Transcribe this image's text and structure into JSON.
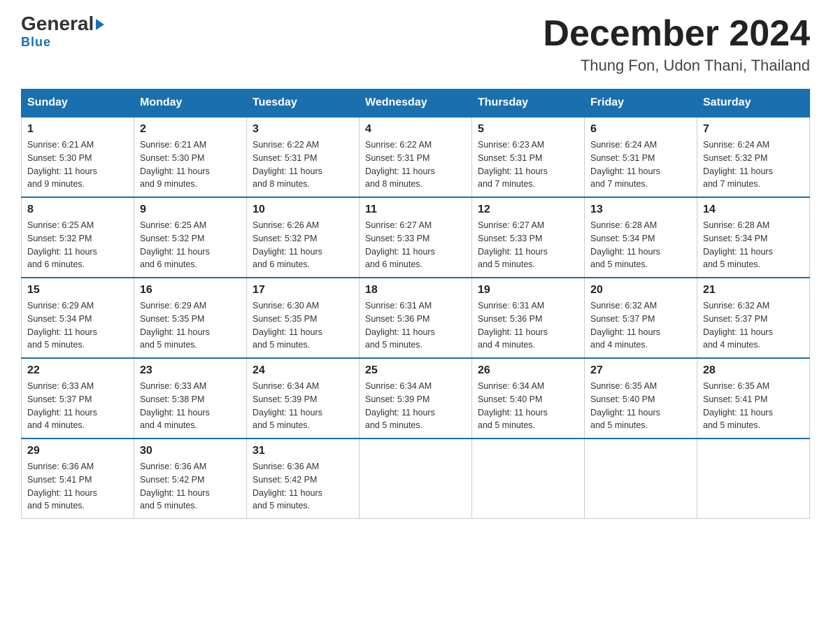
{
  "header": {
    "logo_general": "General",
    "logo_blue": "Blue",
    "month_title": "December 2024",
    "location": "Thung Fon, Udon Thani, Thailand"
  },
  "weekdays": [
    "Sunday",
    "Monday",
    "Tuesday",
    "Wednesday",
    "Thursday",
    "Friday",
    "Saturday"
  ],
  "weeks": [
    [
      {
        "day": "1",
        "sunrise": "6:21 AM",
        "sunset": "5:30 PM",
        "daylight": "11 hours and 9 minutes."
      },
      {
        "day": "2",
        "sunrise": "6:21 AM",
        "sunset": "5:30 PM",
        "daylight": "11 hours and 9 minutes."
      },
      {
        "day": "3",
        "sunrise": "6:22 AM",
        "sunset": "5:31 PM",
        "daylight": "11 hours and 8 minutes."
      },
      {
        "day": "4",
        "sunrise": "6:22 AM",
        "sunset": "5:31 PM",
        "daylight": "11 hours and 8 minutes."
      },
      {
        "day": "5",
        "sunrise": "6:23 AM",
        "sunset": "5:31 PM",
        "daylight": "11 hours and 7 minutes."
      },
      {
        "day": "6",
        "sunrise": "6:24 AM",
        "sunset": "5:31 PM",
        "daylight": "11 hours and 7 minutes."
      },
      {
        "day": "7",
        "sunrise": "6:24 AM",
        "sunset": "5:32 PM",
        "daylight": "11 hours and 7 minutes."
      }
    ],
    [
      {
        "day": "8",
        "sunrise": "6:25 AM",
        "sunset": "5:32 PM",
        "daylight": "11 hours and 6 minutes."
      },
      {
        "day": "9",
        "sunrise": "6:25 AM",
        "sunset": "5:32 PM",
        "daylight": "11 hours and 6 minutes."
      },
      {
        "day": "10",
        "sunrise": "6:26 AM",
        "sunset": "5:32 PM",
        "daylight": "11 hours and 6 minutes."
      },
      {
        "day": "11",
        "sunrise": "6:27 AM",
        "sunset": "5:33 PM",
        "daylight": "11 hours and 6 minutes."
      },
      {
        "day": "12",
        "sunrise": "6:27 AM",
        "sunset": "5:33 PM",
        "daylight": "11 hours and 5 minutes."
      },
      {
        "day": "13",
        "sunrise": "6:28 AM",
        "sunset": "5:34 PM",
        "daylight": "11 hours and 5 minutes."
      },
      {
        "day": "14",
        "sunrise": "6:28 AM",
        "sunset": "5:34 PM",
        "daylight": "11 hours and 5 minutes."
      }
    ],
    [
      {
        "day": "15",
        "sunrise": "6:29 AM",
        "sunset": "5:34 PM",
        "daylight": "11 hours and 5 minutes."
      },
      {
        "day": "16",
        "sunrise": "6:29 AM",
        "sunset": "5:35 PM",
        "daylight": "11 hours and 5 minutes."
      },
      {
        "day": "17",
        "sunrise": "6:30 AM",
        "sunset": "5:35 PM",
        "daylight": "11 hours and 5 minutes."
      },
      {
        "day": "18",
        "sunrise": "6:31 AM",
        "sunset": "5:36 PM",
        "daylight": "11 hours and 5 minutes."
      },
      {
        "day": "19",
        "sunrise": "6:31 AM",
        "sunset": "5:36 PM",
        "daylight": "11 hours and 4 minutes."
      },
      {
        "day": "20",
        "sunrise": "6:32 AM",
        "sunset": "5:37 PM",
        "daylight": "11 hours and 4 minutes."
      },
      {
        "day": "21",
        "sunrise": "6:32 AM",
        "sunset": "5:37 PM",
        "daylight": "11 hours and 4 minutes."
      }
    ],
    [
      {
        "day": "22",
        "sunrise": "6:33 AM",
        "sunset": "5:37 PM",
        "daylight": "11 hours and 4 minutes."
      },
      {
        "day": "23",
        "sunrise": "6:33 AM",
        "sunset": "5:38 PM",
        "daylight": "11 hours and 4 minutes."
      },
      {
        "day": "24",
        "sunrise": "6:34 AM",
        "sunset": "5:39 PM",
        "daylight": "11 hours and 5 minutes."
      },
      {
        "day": "25",
        "sunrise": "6:34 AM",
        "sunset": "5:39 PM",
        "daylight": "11 hours and 5 minutes."
      },
      {
        "day": "26",
        "sunrise": "6:34 AM",
        "sunset": "5:40 PM",
        "daylight": "11 hours and 5 minutes."
      },
      {
        "day": "27",
        "sunrise": "6:35 AM",
        "sunset": "5:40 PM",
        "daylight": "11 hours and 5 minutes."
      },
      {
        "day": "28",
        "sunrise": "6:35 AM",
        "sunset": "5:41 PM",
        "daylight": "11 hours and 5 minutes."
      }
    ],
    [
      {
        "day": "29",
        "sunrise": "6:36 AM",
        "sunset": "5:41 PM",
        "daylight": "11 hours and 5 minutes."
      },
      {
        "day": "30",
        "sunrise": "6:36 AM",
        "sunset": "5:42 PM",
        "daylight": "11 hours and 5 minutes."
      },
      {
        "day": "31",
        "sunrise": "6:36 AM",
        "sunset": "5:42 PM",
        "daylight": "11 hours and 5 minutes."
      },
      null,
      null,
      null,
      null
    ]
  ],
  "labels": {
    "sunrise": "Sunrise:",
    "sunset": "Sunset:",
    "daylight": "Daylight:"
  }
}
